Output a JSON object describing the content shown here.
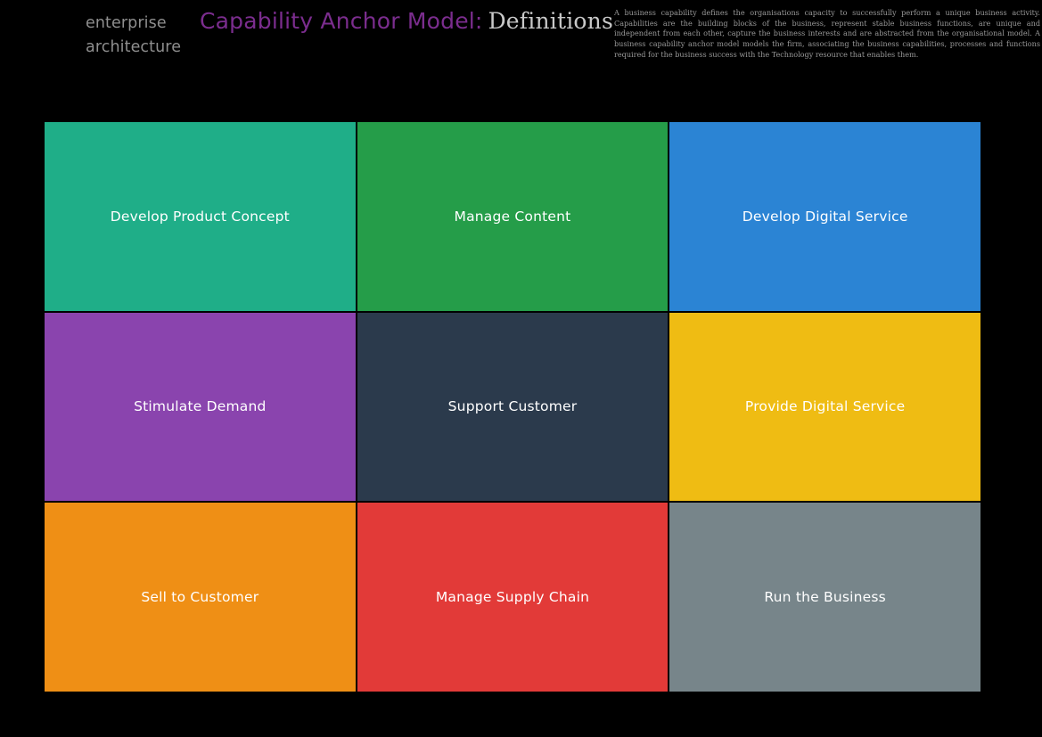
{
  "header": {
    "brand_line1": "enterprise",
    "brand_line2": "architecture",
    "title_main": "Capability Anchor Model:",
    "title_sub": "Definitions",
    "abstract": "A business capability defines the organisations capacity to successfully perform a unique business activity. Capabilities are the building blocks of the business, represent stable business functions, are unique and independent from each other, capture the business interests and are abstracted from the organisational model. A business capability anchor model models the firm, associating the business capabilities, processes and functions required for the business success with the Technology resource that enables them.",
    "colors": {
      "brand_text": "#8f8f8f",
      "title_main": "#7b2d8e",
      "title_sub": "#c9c9c9",
      "abstract_text": "#9a9a9a",
      "background": "#000000"
    }
  },
  "matrix": {
    "rows": 3,
    "columns": 3,
    "cells": [
      {
        "label": "Develop Product Concept",
        "color": "#1fae88"
      },
      {
        "label": "Manage Content",
        "color": "#259d49"
      },
      {
        "label": "Develop Digital Service",
        "color": "#2b84d4"
      },
      {
        "label": "Stimulate Demand",
        "color": "#8a44ae"
      },
      {
        "label": "Support Customer",
        "color": "#2b3a4c"
      },
      {
        "label": "Provide Digital Service",
        "color": "#efbc13"
      },
      {
        "label": "Sell to Customer",
        "color": "#ef8f15"
      },
      {
        "label": "Manage Supply Chain",
        "color": "#e23a38"
      },
      {
        "label": "Run the Business",
        "color": "#77858a"
      }
    ]
  }
}
